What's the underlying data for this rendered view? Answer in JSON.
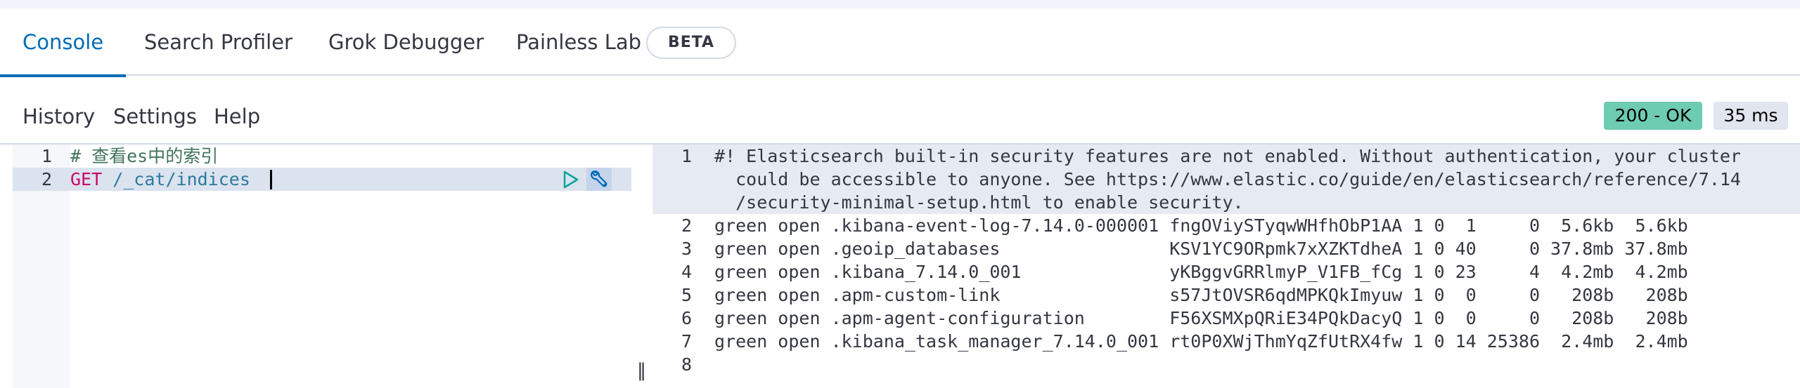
{
  "tabs": [
    {
      "label": "Console"
    },
    {
      "label": "Search Profiler"
    },
    {
      "label": "Grok Debugger"
    },
    {
      "label": "Painless Lab"
    }
  ],
  "beta_badge": "BETA",
  "menu": {
    "history": "History",
    "settings": "Settings",
    "help": "Help"
  },
  "status": {
    "code": "200 - OK",
    "time": "35 ms",
    "ok_color": "#6dccb1"
  },
  "editor": {
    "lines": [
      {
        "num": "1",
        "text": "# 查看es中的索引"
      },
      {
        "num": "2",
        "method": "GET",
        "path": " /_cat/indices "
      }
    ],
    "icons": [
      "play-icon",
      "wrench-icon"
    ]
  },
  "output": {
    "line_numbers": [
      "1",
      "2",
      "3",
      "4",
      "5",
      "6",
      "7",
      "8"
    ],
    "lines": [
      "#! Elasticsearch built-in security features are not enabled. Without authentication, your cluster",
      "  could be accessible to anyone. See https://www.elastic.co/guide/en/elasticsearch/reference/7.14",
      "  /security-minimal-setup.html to enable security.",
      "green open .kibana-event-log-7.14.0-000001 fngOViySTyqwWHfhObP1AA 1 0  1     0  5.6kb  5.6kb",
      "green open .geoip_databases                KSV1YC9ORpmk7xXZKTdheA 1 0 40     0 37.8mb 37.8mb",
      "green open .kibana_7.14.0_001              yKBggvGRRlmyP_V1FB_fCg 1 0 23     4  4.2mb  4.2mb",
      "green open .apm-custom-link                s57JtOVSR6qdMPKQkImyuw 1 0  0     0   208b   208b",
      "green open .apm-agent-configuration        F56XSMXpQRiE34PQkDacyQ 1 0  0     0   208b   208b",
      "green open .kibana_task_manager_7.14.0_001 rt0P0XWjThmYqZfUtRX4fw 1 0 14 25386  2.4mb  2.4mb"
    ]
  }
}
